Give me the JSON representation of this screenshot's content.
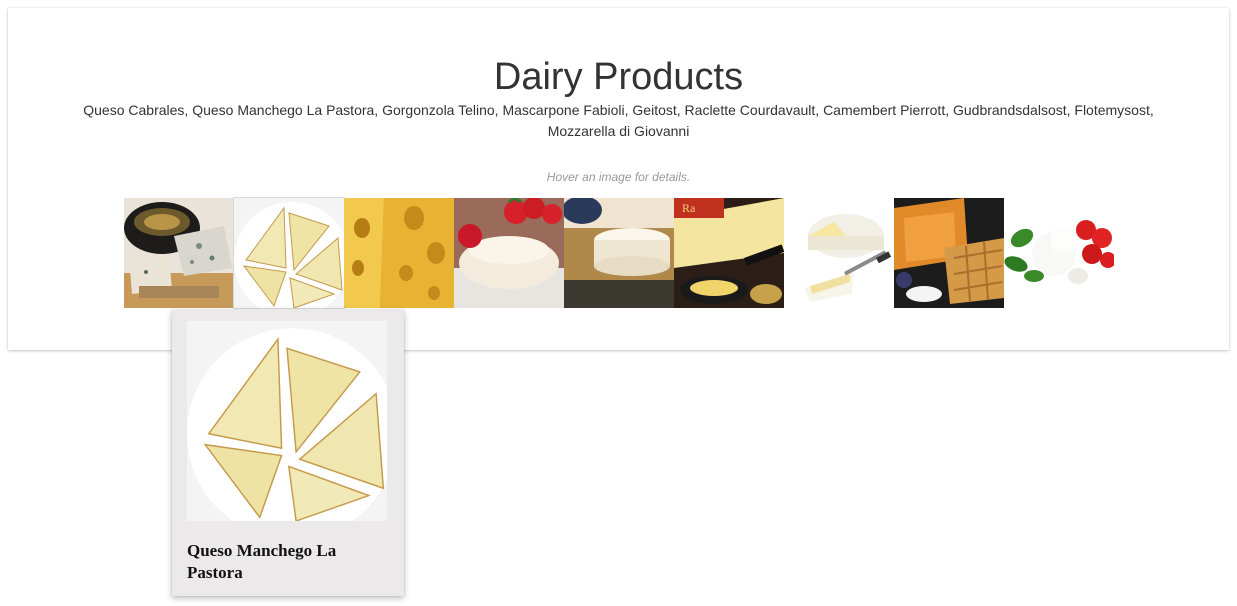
{
  "page": {
    "title": "Dairy Products",
    "product_list": "Queso Cabrales, Queso Manchego La Pastora, Gorgonzola Telino, Mascarpone Fabioli, Geitost, Raclette Courdavault, Camembert Pierrott, Gudbrandsdalsost, Flotemysost, Mozzarella di Giovanni",
    "hint": "Hover an image for details."
  },
  "products": [
    {
      "name": "Queso Cabrales",
      "icon": "blue-cheese-image"
    },
    {
      "name": "Queso Manchego La Pastora",
      "icon": "manchego-wedges-image"
    },
    {
      "name": "Gorgonzola Telino",
      "icon": "swiss-cheese-image"
    },
    {
      "name": "Mascarpone Fabioli",
      "icon": "mascarpone-strawberries-image"
    },
    {
      "name": "Geitost",
      "icon": "white-cheese-wheel-image"
    },
    {
      "name": "Raclette Courdavault",
      "icon": "raclette-pan-image"
    },
    {
      "name": "Camembert Pierrott",
      "icon": "camembert-image"
    },
    {
      "name": "Gudbrandsdalsost",
      "icon": "brown-cheese-waffles-image"
    },
    {
      "name": "Flotemysost",
      "icon": "mozzarella-tomatoes-image"
    }
  ],
  "tooltip": {
    "name": "Queso Manchego La Pastora",
    "icon": "manchego-wedges-image"
  },
  "colors": {
    "title": "#333333",
    "hint": "#999999",
    "tooltip_bg": "#ebe9e9"
  }
}
